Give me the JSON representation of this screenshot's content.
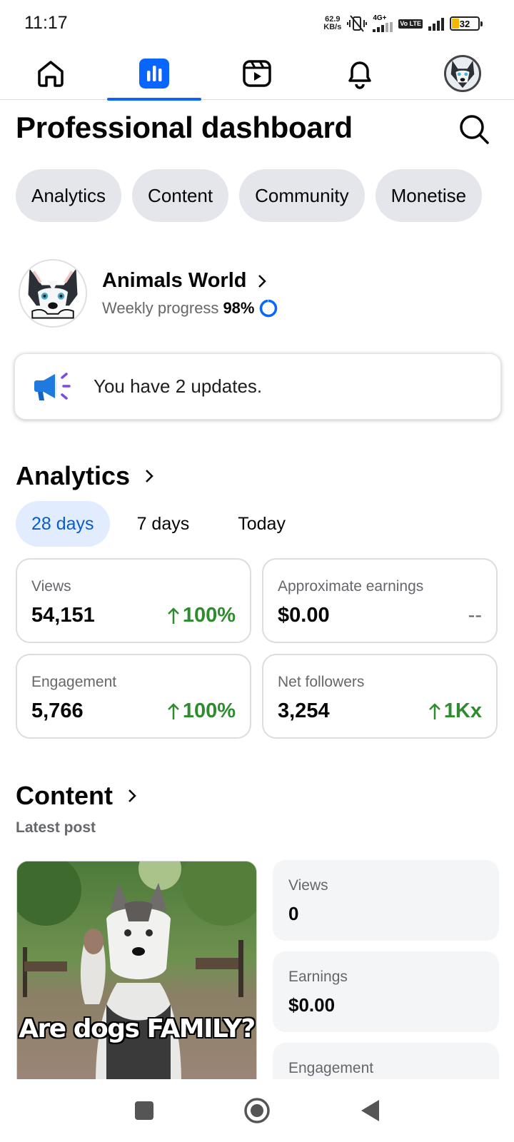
{
  "status_bar": {
    "time": "11:17",
    "net_speed_value": "62.9",
    "net_speed_unit": "KB/s",
    "network_type": "4G+",
    "volte": "Vo LTE",
    "battery": "32"
  },
  "top_nav": {
    "tabs": [
      {
        "icon": "home-icon",
        "active": false
      },
      {
        "icon": "dashboard-icon",
        "active": true
      },
      {
        "icon": "video-icon",
        "active": false
      },
      {
        "icon": "bell-icon",
        "active": false
      },
      {
        "icon": "profile-avatar",
        "active": false
      }
    ],
    "accent_color": "#0866ff"
  },
  "header": {
    "title": "Professional dashboard"
  },
  "chips": [
    "Analytics",
    "Content",
    "Community",
    "Monetise"
  ],
  "profile": {
    "name": "Animals World",
    "progress_label": "Weekly progress",
    "progress_value": "98%",
    "progress_fraction": 0.98
  },
  "updates": {
    "text": "You have 2 updates."
  },
  "analytics": {
    "title": "Analytics",
    "ranges": [
      "28 days",
      "7 days",
      "Today"
    ],
    "active_range": "28 days",
    "metrics": [
      {
        "label": "Views",
        "value": "54,151",
        "change": "100%",
        "trend": "up"
      },
      {
        "label": "Approximate earnings",
        "value": "$0.00",
        "change": "--",
        "trend": "none"
      },
      {
        "label": "Engagement",
        "value": "5,766",
        "change": "100%",
        "trend": "up"
      },
      {
        "label": "Net followers",
        "value": "3,254",
        "change": "1Kx",
        "trend": "up"
      }
    ],
    "positive_color": "#2e8b2e"
  },
  "content": {
    "title": "Content",
    "subtitle": "Latest post",
    "post_caption": "Are dogs FAMILY?",
    "stats": [
      {
        "label": "Views",
        "value": "0"
      },
      {
        "label": "Earnings",
        "value": "$0.00"
      },
      {
        "label": "Engagement",
        "value": ""
      }
    ]
  }
}
